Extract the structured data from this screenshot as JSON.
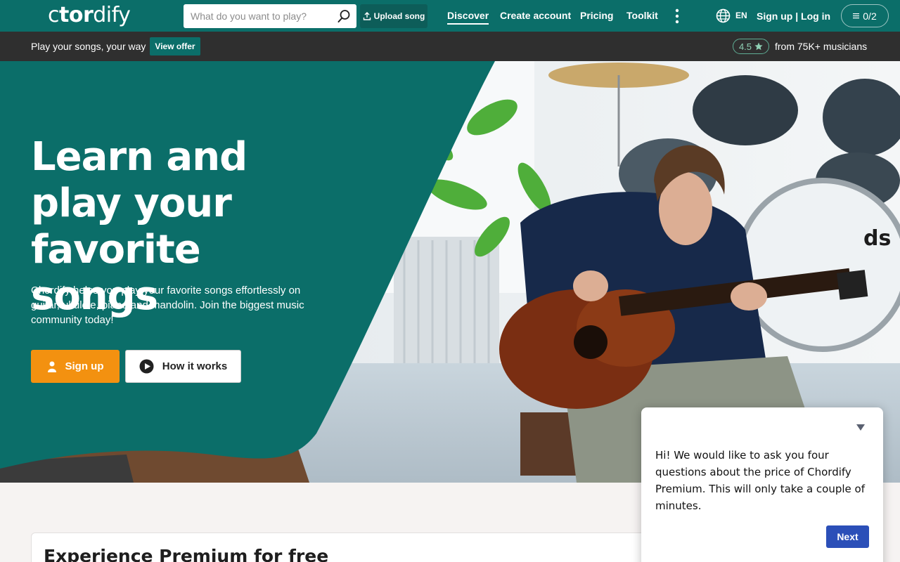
{
  "nav": {
    "logo": {
      "part1": "c",
      "part2": "tor",
      "part3": "dify"
    },
    "search": {
      "placeholder": "What do you want to play?",
      "value": "",
      "icon": "search-icon"
    },
    "upload_label": "Upload song",
    "links": {
      "discover": "Discover",
      "create_account": "Create account",
      "pricing": "Pricing",
      "toolkit": "Toolkit"
    },
    "language": "EN",
    "auth": "Sign up | Log in",
    "counter": "0/2"
  },
  "promo": {
    "text": "Play your songs, your way",
    "offer_label": "View offer",
    "rating": "4.5",
    "rating_text": "from 75K+ musicians"
  },
  "hero": {
    "title": "Learn and play your favorite songs",
    "subtitle": "Chordify helps you play your favorite songs effortlessly on guitar, ukulele, piano and mandolin. Join the biggest music community today!",
    "signup_label": "Sign up",
    "how_label": "How it works"
  },
  "premium": {
    "title": "Experience Premium for free"
  },
  "survey": {
    "text": "Hi! We would like to ask you four questions about the price of Chordify Premium. This will only take a couple of minutes.",
    "next_label": "Next"
  },
  "colors": {
    "brand_teal": "#0b6e69",
    "promo_bg": "#2f2f2f",
    "signup_orange": "#f39110",
    "next_blue": "#2b4fb8"
  }
}
